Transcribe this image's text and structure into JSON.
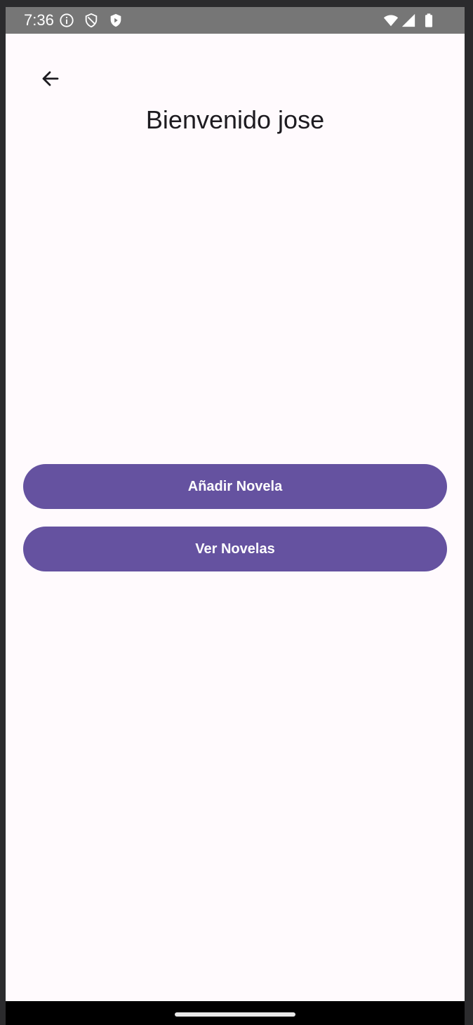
{
  "status_bar": {
    "time": "7:36",
    "icons_left": [
      "info-icon",
      "shield-outline-icon",
      "shield-play-icon"
    ],
    "icons_right": [
      "wifi-icon",
      "signal-icon",
      "battery-icon"
    ]
  },
  "header": {
    "back_icon": "arrow-left-icon",
    "title": "Bienvenido jose"
  },
  "actions": {
    "add_novel_label": "Añadir Novela",
    "view_novels_label": "Ver Novelas"
  },
  "colors": {
    "primary": "#6552a0",
    "background": "#fffafd",
    "status_bar": "#767676",
    "on_surface": "#1d1b20"
  }
}
